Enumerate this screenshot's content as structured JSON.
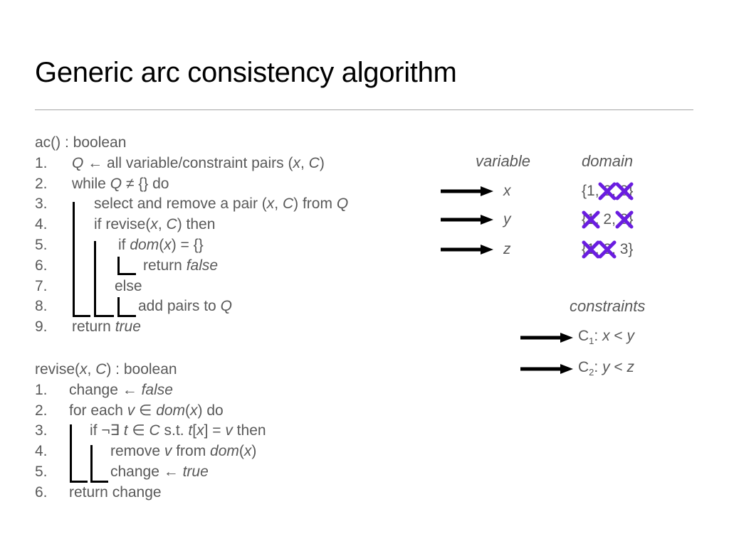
{
  "title": "Generic arc consistency algorithm",
  "ac": {
    "signature": "ac() : boolean",
    "lines": [
      {
        "num": "1.",
        "parts": [
          [
            "i",
            "Q"
          ],
          [
            "n",
            " ← all variable/constraint pairs ("
          ],
          [
            "i",
            "x"
          ],
          [
            "n",
            ", "
          ],
          [
            "i",
            "C"
          ],
          [
            "n",
            ")"
          ]
        ]
      },
      {
        "num": "2.",
        "parts": [
          [
            "n",
            "while "
          ],
          [
            "i",
            "Q"
          ],
          [
            "n",
            " ≠ {} do"
          ]
        ]
      },
      {
        "num": "3.",
        "parts": [
          [
            "n",
            "select and remove a pair ("
          ],
          [
            "i",
            "x"
          ],
          [
            "n",
            ", "
          ],
          [
            "i",
            "C"
          ],
          [
            "n",
            ") from "
          ],
          [
            "i",
            "Q"
          ]
        ]
      },
      {
        "num": "4.",
        "parts": [
          [
            "n",
            "if revise("
          ],
          [
            "i",
            "x"
          ],
          [
            "n",
            ", "
          ],
          [
            "i",
            "C"
          ],
          [
            "n",
            ") then"
          ]
        ]
      },
      {
        "num": "5.",
        "parts": [
          [
            "n",
            "if "
          ],
          [
            "i",
            "dom"
          ],
          [
            "n",
            "("
          ],
          [
            "i",
            "x"
          ],
          [
            "n",
            ") = {}"
          ]
        ]
      },
      {
        "num": "6.",
        "parts": [
          [
            "n",
            "return "
          ],
          [
            "i",
            "false"
          ]
        ]
      },
      {
        "num": "7.",
        "parts": [
          [
            "n",
            "else"
          ]
        ]
      },
      {
        "num": "8.",
        "parts": [
          [
            "n",
            "add pairs to "
          ],
          [
            "i",
            "Q"
          ]
        ]
      },
      {
        "num": "9.",
        "parts": [
          [
            "n",
            "return "
          ],
          [
            "i",
            "true"
          ]
        ]
      }
    ]
  },
  "revise": {
    "signature_parts": [
      [
        "n",
        "revise("
      ],
      [
        "i",
        "x"
      ],
      [
        "n",
        ", "
      ],
      [
        "i",
        "C"
      ],
      [
        "n",
        ") : boolean"
      ]
    ],
    "lines": [
      {
        "num": "1.",
        "parts": [
          [
            "n",
            "change ← "
          ],
          [
            "i",
            "false"
          ]
        ]
      },
      {
        "num": "2.",
        "parts": [
          [
            "n",
            "for each "
          ],
          [
            "i",
            "v"
          ],
          [
            "n",
            " ∈ "
          ],
          [
            "i",
            "dom"
          ],
          [
            "n",
            "("
          ],
          [
            "i",
            "x"
          ],
          [
            "n",
            ") do"
          ]
        ]
      },
      {
        "num": "3.",
        "parts": [
          [
            "n",
            "if ¬∃ "
          ],
          [
            "i",
            "t"
          ],
          [
            "n",
            " ∈ "
          ],
          [
            "i",
            "C"
          ],
          [
            "n",
            " s.t. "
          ],
          [
            "i",
            "t"
          ],
          [
            "n",
            "["
          ],
          [
            "i",
            "x"
          ],
          [
            "n",
            "] = "
          ],
          [
            "i",
            "v"
          ],
          [
            "n",
            " then"
          ]
        ]
      },
      {
        "num": "4.",
        "parts": [
          [
            "n",
            "remove "
          ],
          [
            "i",
            "v"
          ],
          [
            "n",
            " from "
          ],
          [
            "i",
            "dom"
          ],
          [
            "n",
            "("
          ],
          [
            "i",
            "x"
          ],
          [
            "n",
            ")"
          ]
        ]
      },
      {
        "num": "5.",
        "parts": [
          [
            "n",
            "change ← "
          ],
          [
            "i",
            "true"
          ]
        ]
      },
      {
        "num": "6.",
        "parts": [
          [
            "n",
            "return change"
          ]
        ]
      }
    ]
  },
  "table": {
    "variable_header": "variable",
    "domain_header": "domain",
    "rows": [
      {
        "var": "x",
        "values": [
          "1",
          "2",
          "3"
        ],
        "removed": [
          false,
          true,
          true
        ]
      },
      {
        "var": "y",
        "values": [
          "1",
          "2",
          "3"
        ],
        "removed": [
          true,
          false,
          true
        ]
      },
      {
        "var": "z",
        "values": [
          "1",
          "2",
          "3"
        ],
        "removed": [
          true,
          true,
          false
        ]
      }
    ]
  },
  "constraints": {
    "header": "constraints",
    "items": [
      {
        "name": "C",
        "sub": "1",
        "expr": [
          [
            "i",
            "x"
          ],
          [
            "n",
            " < "
          ],
          [
            "i",
            "y"
          ]
        ]
      },
      {
        "name": "C",
        "sub": "2",
        "expr": [
          [
            "i",
            "y"
          ],
          [
            "n",
            " < "
          ],
          [
            "i",
            "z"
          ]
        ]
      }
    ]
  },
  "colors": {
    "cross": "#6a1de0",
    "text": "#595959",
    "arrow": "#000000"
  }
}
